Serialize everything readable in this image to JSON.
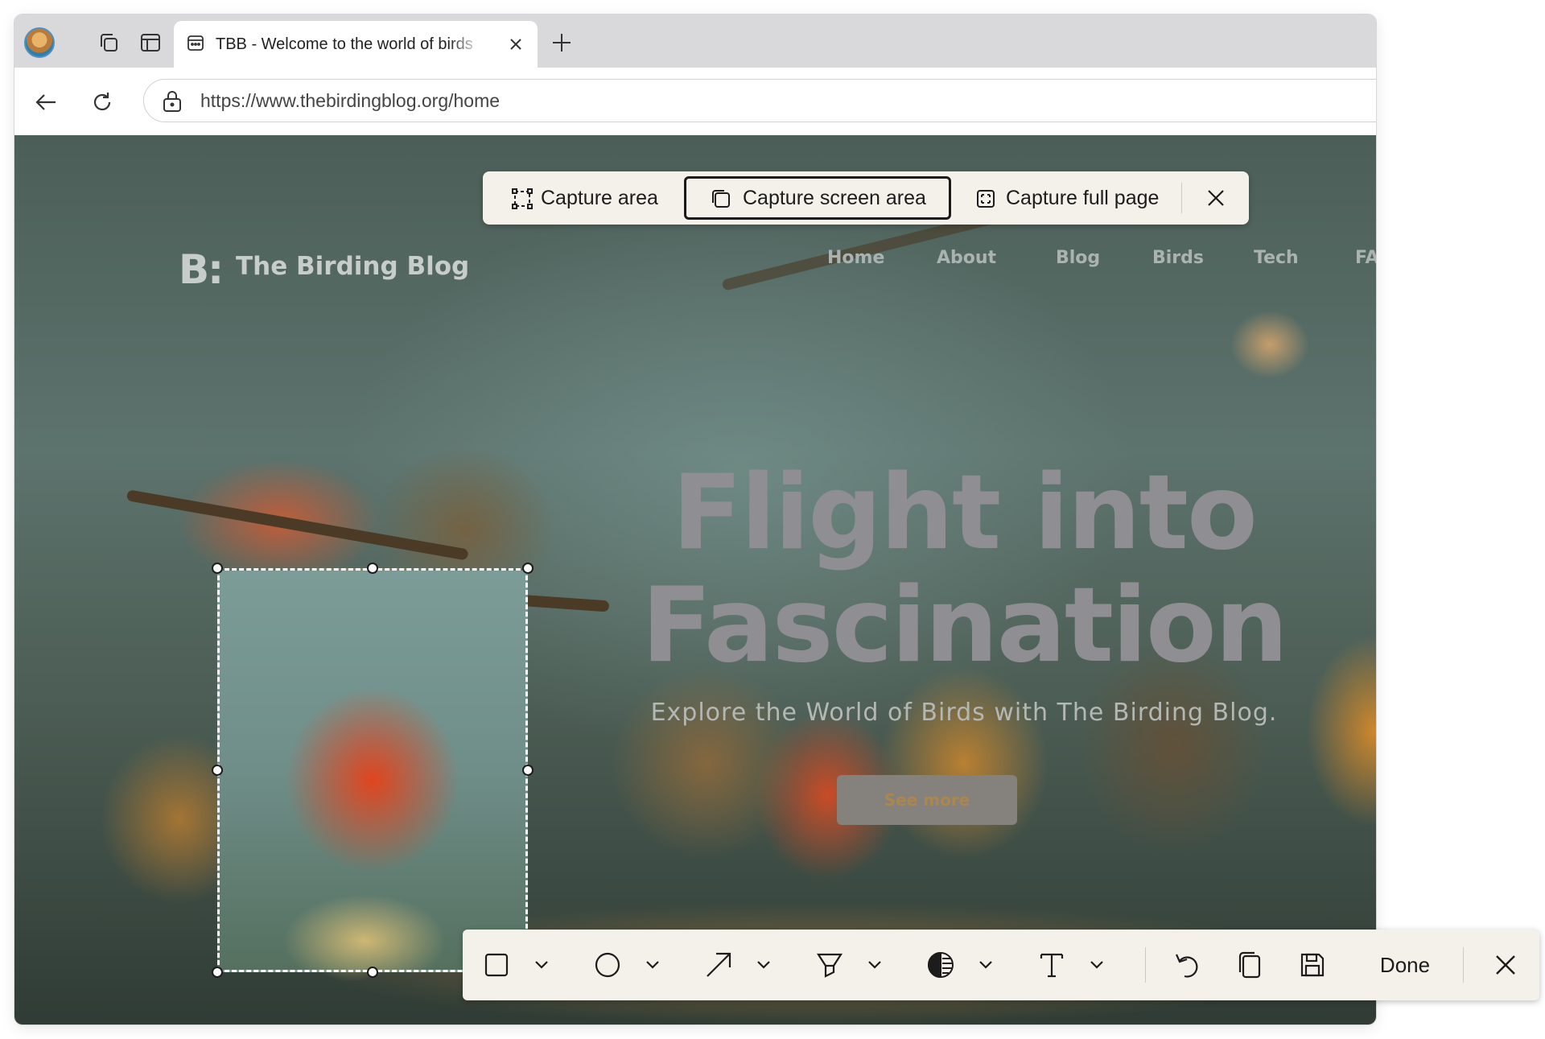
{
  "browser": {
    "profile_icon": "profile-avatar",
    "tab": {
      "title": "TBB - Welcome to the world of birds",
      "favicon": "calendar-icon"
    },
    "address": {
      "url": "https://www.thebirdingblog.org/home"
    }
  },
  "website": {
    "logo_mark": "B:",
    "logo_text": "The Birding Blog",
    "nav": [
      "Home",
      "About",
      "Blog",
      "Birds",
      "Tech",
      "FA"
    ],
    "hero": {
      "title_line1": "Flight into",
      "title_line2": "Fascination",
      "subtitle": "Explore the World of Birds with The Birding Blog.",
      "button_label": "See more"
    }
  },
  "capture_toolbar": {
    "buttons": [
      {
        "label": "Capture area",
        "icon": "capture-area-icon"
      },
      {
        "label": "Capture screen area",
        "icon": "capture-screen-area-icon",
        "selected": true
      },
      {
        "label": "Capture full page",
        "icon": "capture-full-page-icon"
      }
    ]
  },
  "markup_toolbar": {
    "tools": [
      "rectangle-icon",
      "ellipse-icon",
      "arrow-icon",
      "highlighter-icon",
      "fill-icon",
      "text-icon"
    ],
    "done_label": "Done"
  },
  "colors": {
    "toolbar_bg": "#f4f1ea",
    "tabbar_bg": "#d9d9dc",
    "hero_title": "#8f8e92"
  }
}
